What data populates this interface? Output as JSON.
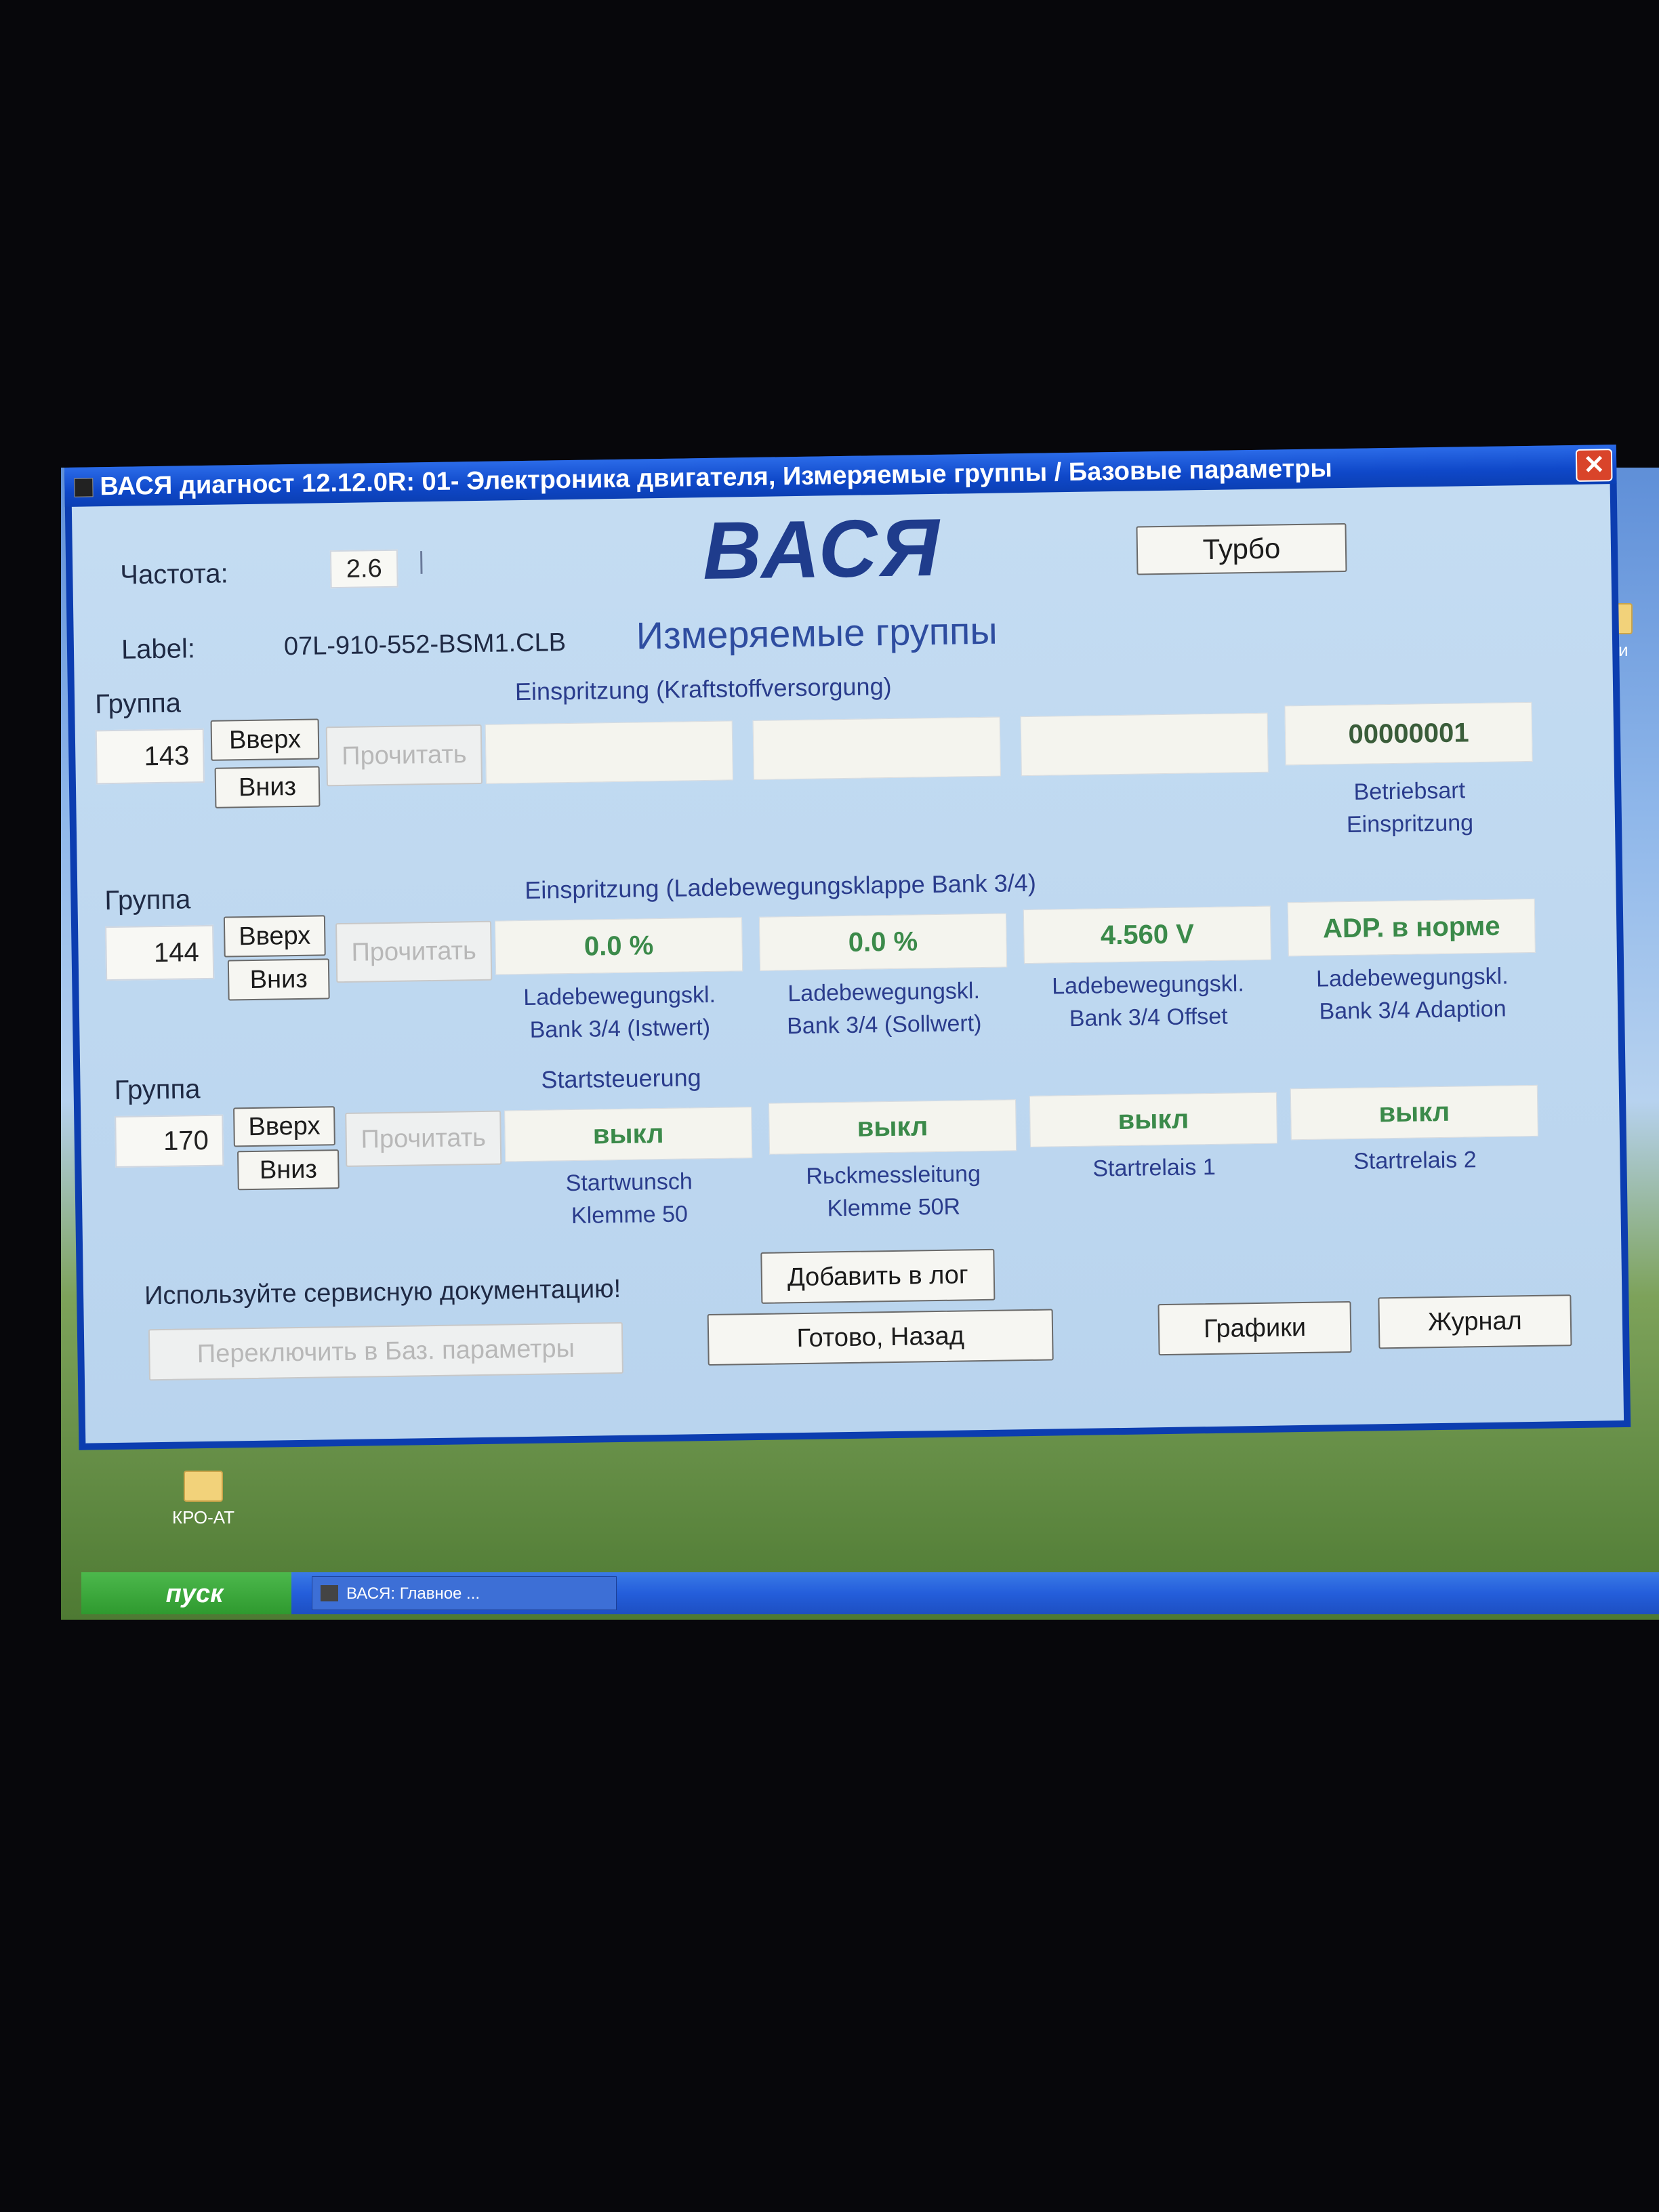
{
  "window": {
    "title": "ВАСЯ диагност 12.12.0R: 01- Электроника двигателя,  Измеряемые группы / Базовые параметры",
    "close_symbol": "✕"
  },
  "top": {
    "freq_label": "Частота:",
    "freq_value": "2.6",
    "freq_marker": "|",
    "logo": "ВАСЯ",
    "turbo_button": "Турбо",
    "label_caption": "Label:",
    "label_value": "07L-910-552-BSM1.CLB",
    "subtitle": "Измеряемые группы"
  },
  "groups": [
    {
      "group_label": "Группа",
      "number": "143",
      "up": "Вверх",
      "down": "Вниз",
      "read": "Прочитать",
      "header": "Einspritzung (Kraftstoffversorgung)",
      "values": [
        "",
        "",
        "",
        "00000001"
      ],
      "captions": [
        "",
        "",
        "",
        "Betriebsart\nEinspritzung"
      ]
    },
    {
      "group_label": "Группа",
      "number": "144",
      "up": "Вверх",
      "down": "Вниз",
      "read": "Прочитать",
      "header": "Einspritzung (Ladebewegungsklappe Bank 3/4)",
      "values": [
        "0.0 %",
        "0.0 %",
        "4.560 V",
        "ADP. в норме"
      ],
      "captions": [
        "Ladebewegungskl.\nBank 3/4 (Istwert)",
        "Ladebewegungskl.\nBank 3/4 (Sollwert)",
        "Ladebewegungskl.\nBank 3/4 Offset",
        "Ladebewegungskl.\nBank 3/4 Adaption"
      ]
    },
    {
      "group_label": "Группа",
      "number": "170",
      "up": "Вверх",
      "down": "Вниз",
      "read": "Прочитать",
      "header": "Startsteuerung",
      "values": [
        "выкл",
        "выкл",
        "выкл",
        "выкл"
      ],
      "captions": [
        "Startwunsch\nKlemme 50",
        "Rьckmessleitung\nKlemme 50R",
        "Startrelais 1",
        "Startrelais 2"
      ]
    }
  ],
  "bottom": {
    "service_note": "Используйте сервисную документацию!",
    "add_log": "Добавить в лог",
    "switch_basic": "Переключить в Баз. параметры",
    "done_back": "Готово, Назад",
    "graphs": "Графики",
    "journal": "Журнал"
  },
  "desktop": {
    "icon_right_label": "юки",
    "icon_bottom_label": "КРО-АТ"
  },
  "taskbar": {
    "start": "пуск",
    "task": "ВАСЯ:  Главное ..."
  }
}
